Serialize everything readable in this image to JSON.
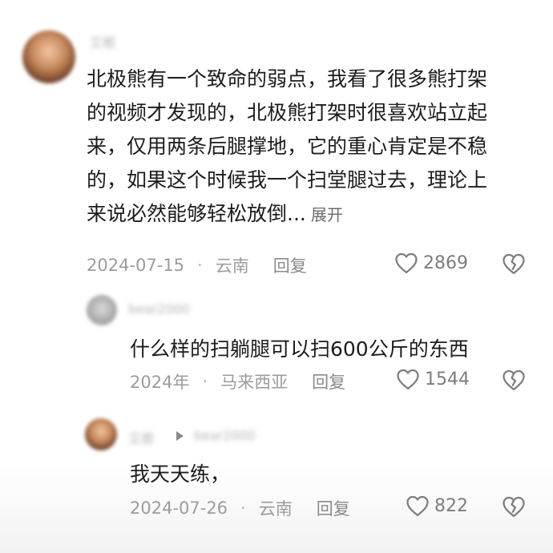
{
  "main_comment": {
    "username": "艾根",
    "lines": [
      "北极熊有一个致命的弱点，我看了很多熊打架",
      "的视频才发现的，北极熊打架时很喜欢站立起",
      "来，仅用两条后腿撑地，它的重心肯定是不稳",
      "的，如果这个时候我一个扫堂腿过去，理论上",
      "来说必然能够轻松放倒..."
    ],
    "expand_label": "展开",
    "date": "2024-07-15",
    "location": "云南",
    "reply_label": "回复",
    "likes": "2869"
  },
  "replies": [
    {
      "username": "bear2000",
      "text": "什么样的扫躺腿可以扫600公斤的东西",
      "date": "2024年",
      "location": "马来西亚",
      "reply_label": "回复",
      "likes": "1544"
    },
    {
      "username": "艾根",
      "reply_to": "bear2000",
      "text": "我天天练，",
      "date": "2024-07-26",
      "location": "云南",
      "reply_label": "回复",
      "likes": "822"
    }
  ],
  "separator": "·",
  "icons": {
    "like": "heart-outline-icon",
    "dislike": "broken-heart-icon"
  },
  "colors": {
    "text": "#1c1c1c",
    "meta": "#9c9c9c",
    "icon": "#7d7d7d"
  }
}
